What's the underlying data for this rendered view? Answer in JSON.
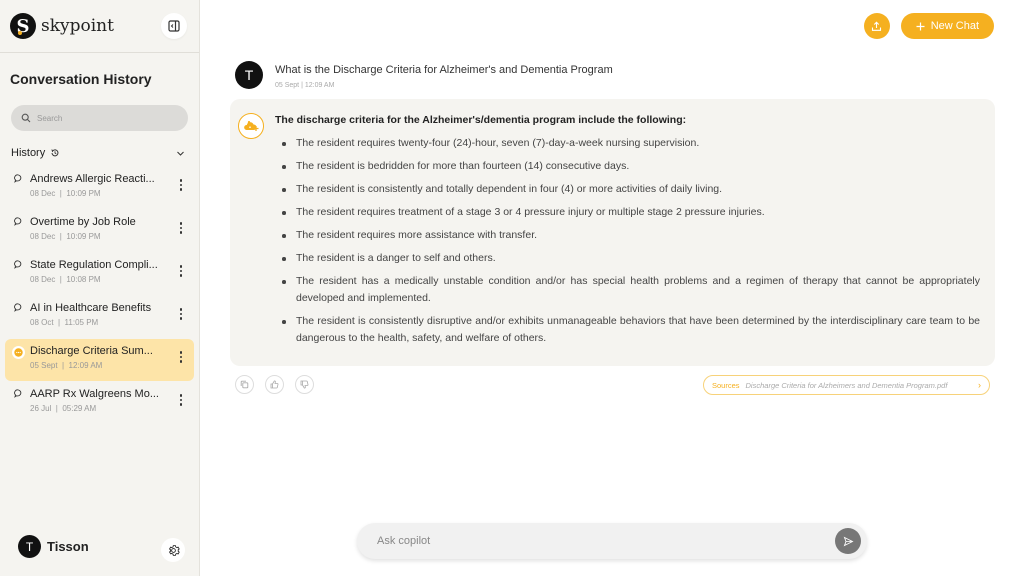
{
  "brand": {
    "name": "skypoint",
    "logo_letter": "S"
  },
  "sidebar": {
    "title": "Conversation History",
    "search_placeholder": "Search",
    "history_label": "History",
    "items": [
      {
        "title": "Andrews Allergic Reacti...",
        "date": "08 Dec",
        "time": "10:09 PM",
        "active": false
      },
      {
        "title": "Overtime by Job Role",
        "date": "08 Dec",
        "time": "10:09 PM",
        "active": false
      },
      {
        "title": "State Regulation Compli...",
        "date": "08 Dec",
        "time": "10:08 PM",
        "active": false
      },
      {
        "title": "AI in Healthcare Benefits",
        "date": "08 Oct",
        "time": "11:05 PM",
        "active": false
      },
      {
        "title": "Discharge Criteria Sum...",
        "date": "05 Sept",
        "time": "12:09 AM",
        "active": true
      },
      {
        "title": "AARP Rx Walgreens Mo...",
        "date": "26 Jul",
        "time": "05:29 AM",
        "active": false
      }
    ],
    "user": {
      "initial": "T",
      "name": "Tisson"
    }
  },
  "header": {
    "new_chat_label": "New Chat"
  },
  "question": {
    "avatar_initial": "T",
    "text": "What is the Discharge Criteria for Alzheimer's and Dementia Program",
    "meta": "05 Sept | 12:09 AM"
  },
  "answer": {
    "heading": "The discharge criteria for the Alzheimer's/dementia program include the following:",
    "bullets": [
      "The resident requires twenty-four (24)-hour, seven (7)-day-a-week nursing supervision.",
      "The resident is bedridden for more than fourteen (14) consecutive days.",
      "The resident is consistently and totally dependent in four (4) or more activities of daily living.",
      "The resident requires treatment of a stage 3 or 4 pressure injury or multiple stage 2 pressure injuries.",
      "The resident requires more assistance with transfer.",
      "The resident is a danger to self and others.",
      "The resident has a medically unstable condition and/or has special health problems and a regimen of therapy that cannot be appropriately developed and implemented.",
      "The resident is consistently disruptive and/or exhibits unmanageable behaviors that have been determined by the interdisciplinary care team to be dangerous to the health, safety, and welfare of others."
    ],
    "sources_label": "Sources",
    "source_file": "Discharge Criteria for Alzheimers and Dementia Program.pdf"
  },
  "composer": {
    "placeholder": "Ask copilot"
  },
  "colors": {
    "accent": "#f5b020",
    "active_item": "#fde4a8",
    "sidebar_bg": "#f5f4f0"
  }
}
